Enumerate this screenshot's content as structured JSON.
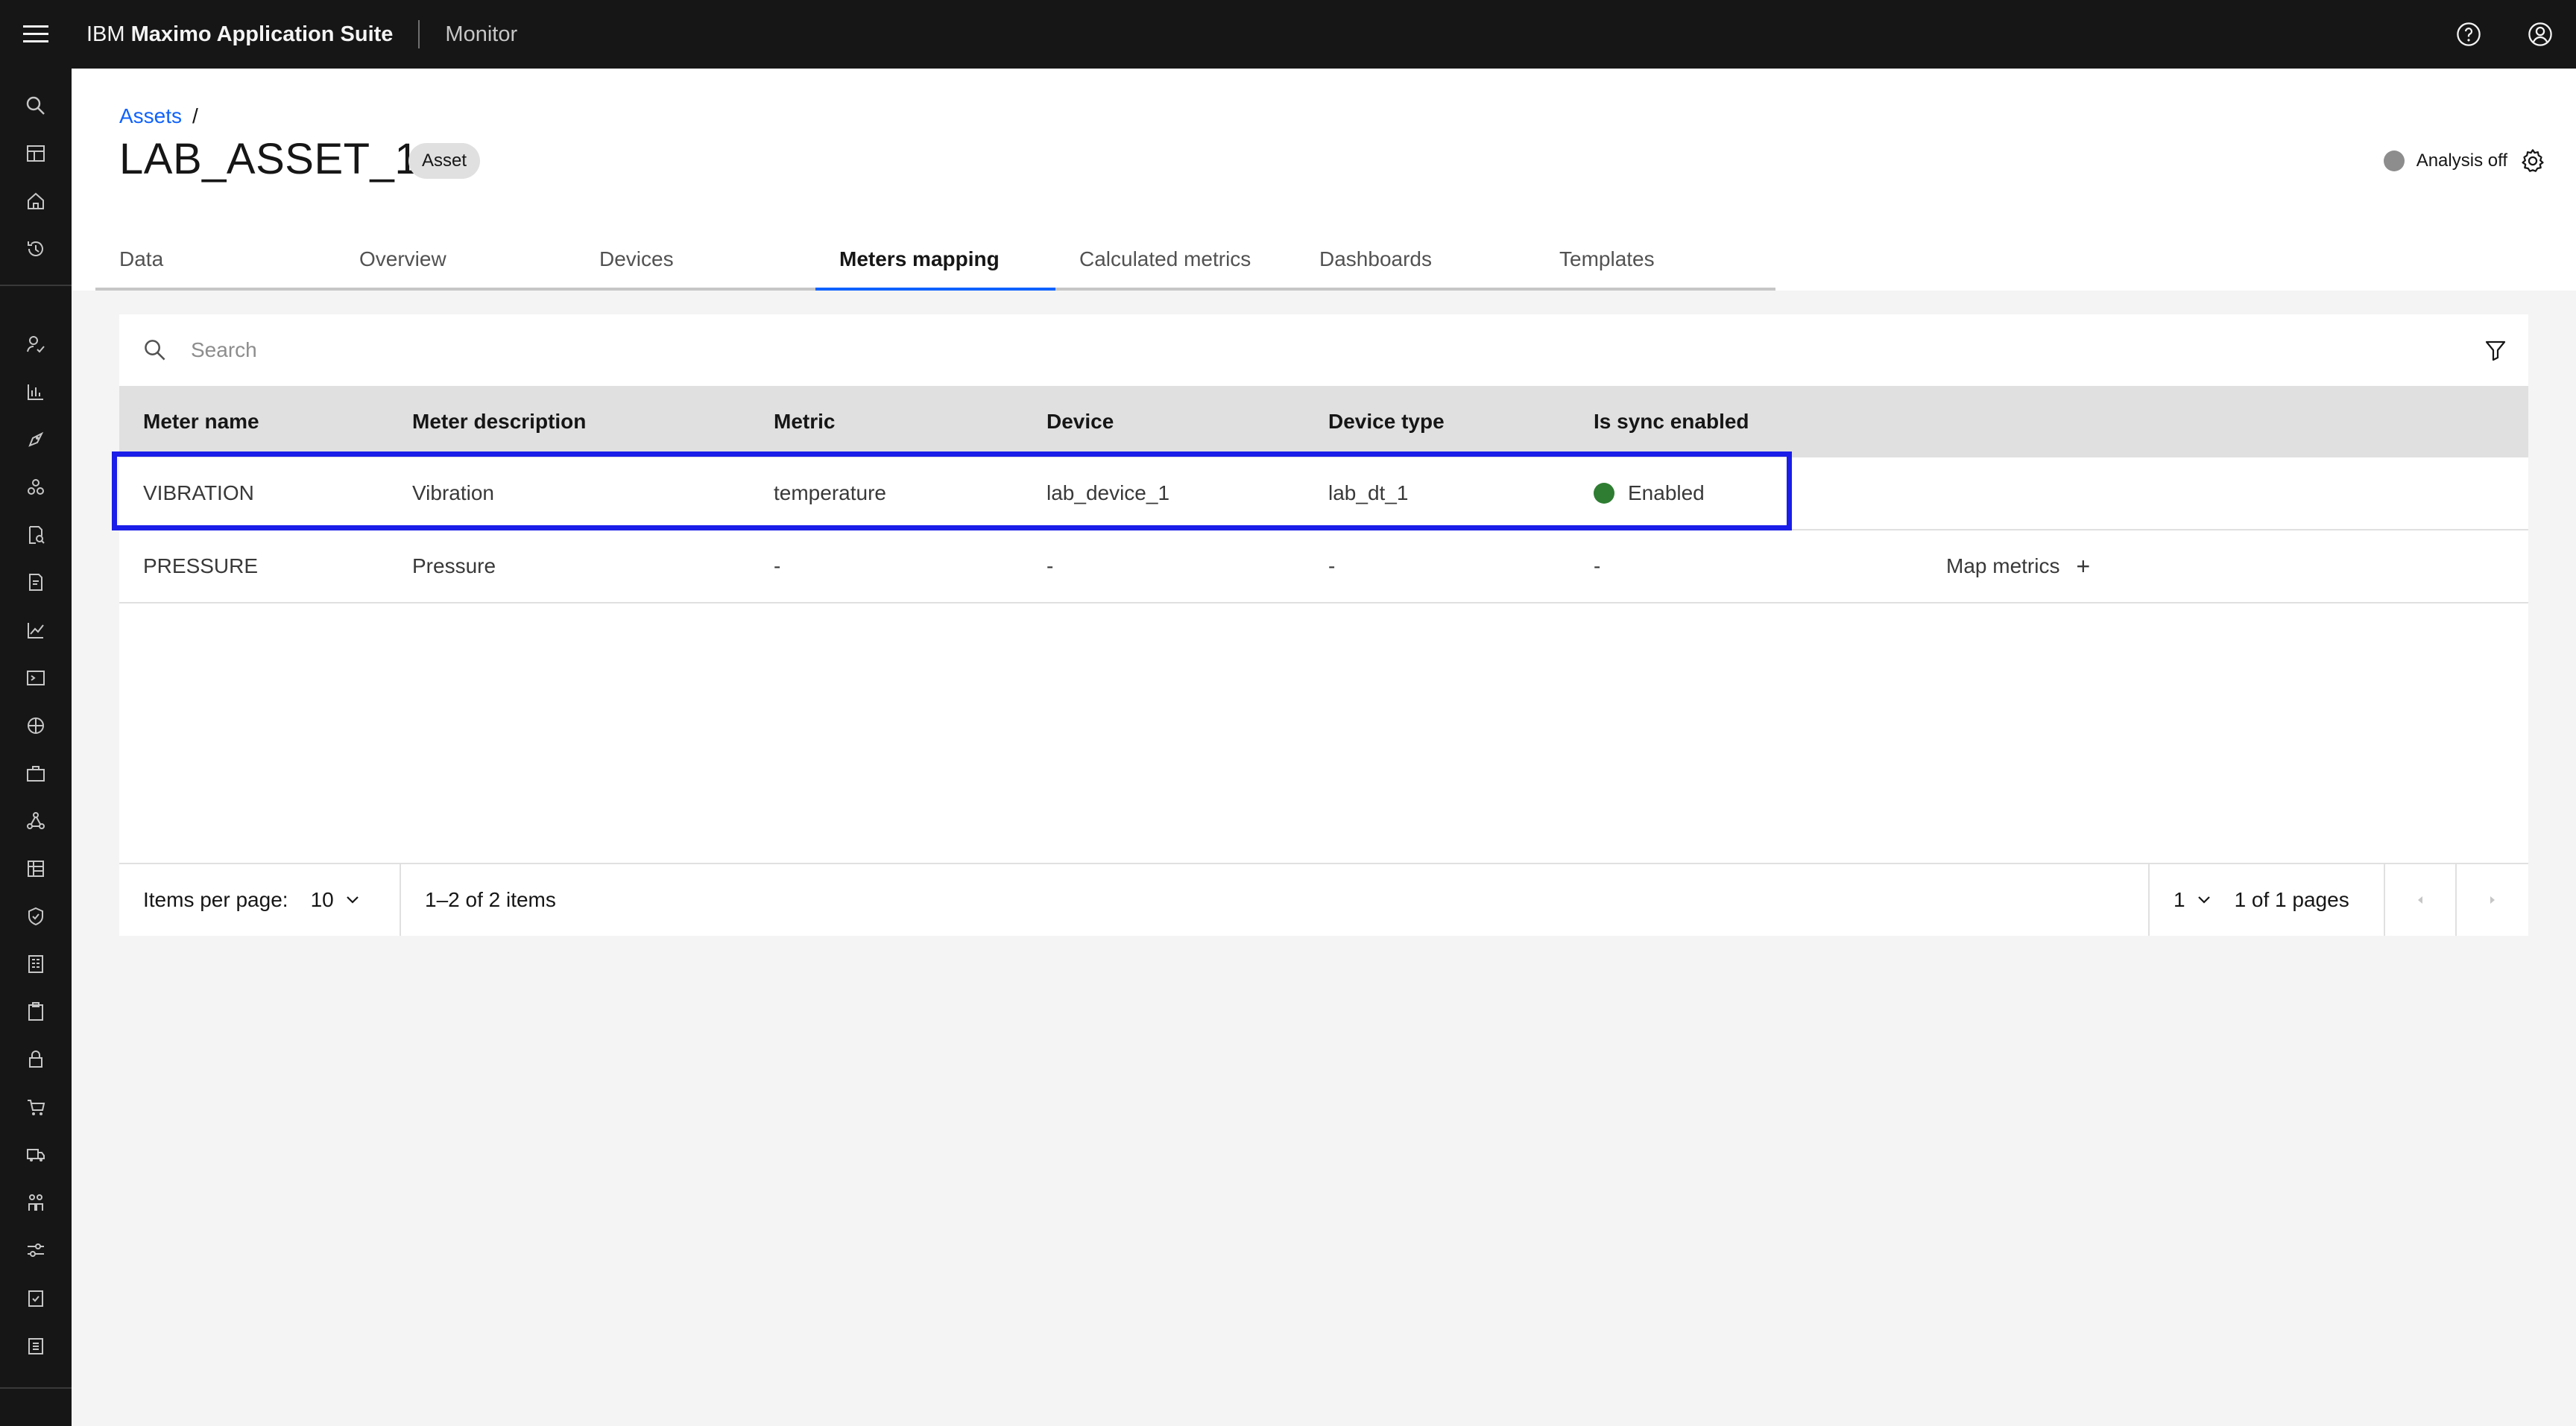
{
  "header": {
    "brand_prefix": "IBM",
    "brand_name": "Maximo Application Suite",
    "app_name": "Monitor"
  },
  "breadcrumb": {
    "parent": "Assets",
    "separator": "/"
  },
  "page": {
    "title": "LAB_ASSET_1",
    "tag": "Asset",
    "analysis_status": "Analysis off"
  },
  "tabs": [
    {
      "label": "Data"
    },
    {
      "label": "Overview"
    },
    {
      "label": "Devices"
    },
    {
      "label": "Meters mapping"
    },
    {
      "label": "Calculated metrics"
    },
    {
      "label": "Dashboards"
    },
    {
      "label": "Templates"
    }
  ],
  "active_tab": "Meters mapping",
  "search": {
    "placeholder": "Search"
  },
  "table": {
    "columns": [
      "Meter name",
      "Meter description",
      "Metric",
      "Device",
      "Device type",
      "Is sync enabled"
    ],
    "rows": [
      {
        "meter_name": "VIBRATION",
        "meter_description": "Vibration",
        "metric": "temperature",
        "device": "lab_device_1",
        "device_type": "lab_dt_1",
        "sync": "Enabled",
        "action": ""
      },
      {
        "meter_name": "PRESSURE",
        "meter_description": "Pressure",
        "metric": "-",
        "device": "-",
        "device_type": "-",
        "sync": "-",
        "action": "Map metrics"
      }
    ]
  },
  "pagination": {
    "items_per_page_label": "Items per page:",
    "items_per_page": "10",
    "range": "1–2 of 2 items",
    "page": "1",
    "page_total": "1 of 1 pages"
  },
  "colors": {
    "accent": "#0f62fe",
    "header_bg": "#161616",
    "sync_enabled": "#2e7d32",
    "highlight": "#1a1ee8"
  },
  "icons": [
    "menu-icon",
    "help-icon",
    "user-icon",
    "search-icon",
    "settings-icon",
    "filter-icon",
    "chevron-down-icon",
    "caret-left-icon",
    "caret-right-icon",
    "add-icon"
  ]
}
